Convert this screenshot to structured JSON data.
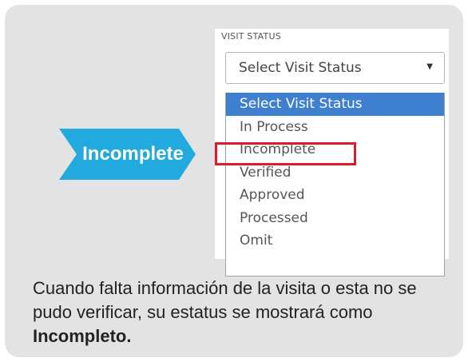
{
  "field": {
    "label": "VISIT STATUS",
    "selected_value": "Select Visit Status"
  },
  "options": [
    {
      "label": "Select Visit Status",
      "selected": true
    },
    {
      "label": "In Process",
      "selected": false
    },
    {
      "label": "Incomplete",
      "selected": false
    },
    {
      "label": "Verified",
      "selected": false
    },
    {
      "label": "Approved",
      "selected": false
    },
    {
      "label": "Processed",
      "selected": false
    },
    {
      "label": "Omit",
      "selected": false
    }
  ],
  "callout": {
    "label": "Incomplete",
    "color": "#22aadf"
  },
  "highlight": {
    "target": "Incomplete",
    "color": "#e2172a"
  },
  "caption": {
    "text": "Cuando falta información de la visita o esta no se pudo verificar, su estatus se mostrará como",
    "bold": "Incompleto."
  }
}
